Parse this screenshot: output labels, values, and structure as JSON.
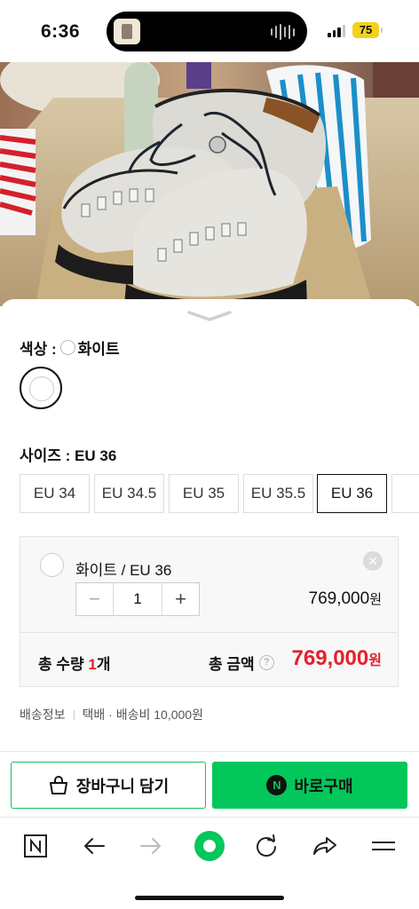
{
  "status_bar": {
    "time": "6:36",
    "battery": "75"
  },
  "color": {
    "title_prefix": "색상 :",
    "selected": "화이트"
  },
  "size": {
    "title": "사이즈 : EU 36",
    "options": [
      "EU 34",
      "EU 34.5",
      "EU 35",
      "EU 35.5",
      "EU 36"
    ],
    "selected": "EU 36"
  },
  "selected_option": {
    "name": "화이트 / EU 36",
    "quantity": "1",
    "price": "769,000",
    "currency": "원",
    "remove_icon": "close-icon"
  },
  "total": {
    "qty_label": "총 수량 ",
    "qty_value": "1",
    "qty_unit": "개",
    "amount_label": "총 금액",
    "amount": "769,000",
    "currency": "원",
    "help_symbol": "?"
  },
  "shipping": {
    "label": "배송정보",
    "detail": "택배 · 배송비 10,000원"
  },
  "buttons": {
    "cart": "장바구니 담기",
    "buy": "바로구매",
    "buy_badge": "N"
  },
  "colors": {
    "accent_green": "#03c75a",
    "price_red": "#e5202b"
  },
  "toolbar_icons": [
    "naver-n-icon",
    "back-arrow-icon",
    "forward-arrow-icon",
    "green-dot-icon",
    "refresh-icon",
    "share-icon",
    "menu-icon"
  ]
}
